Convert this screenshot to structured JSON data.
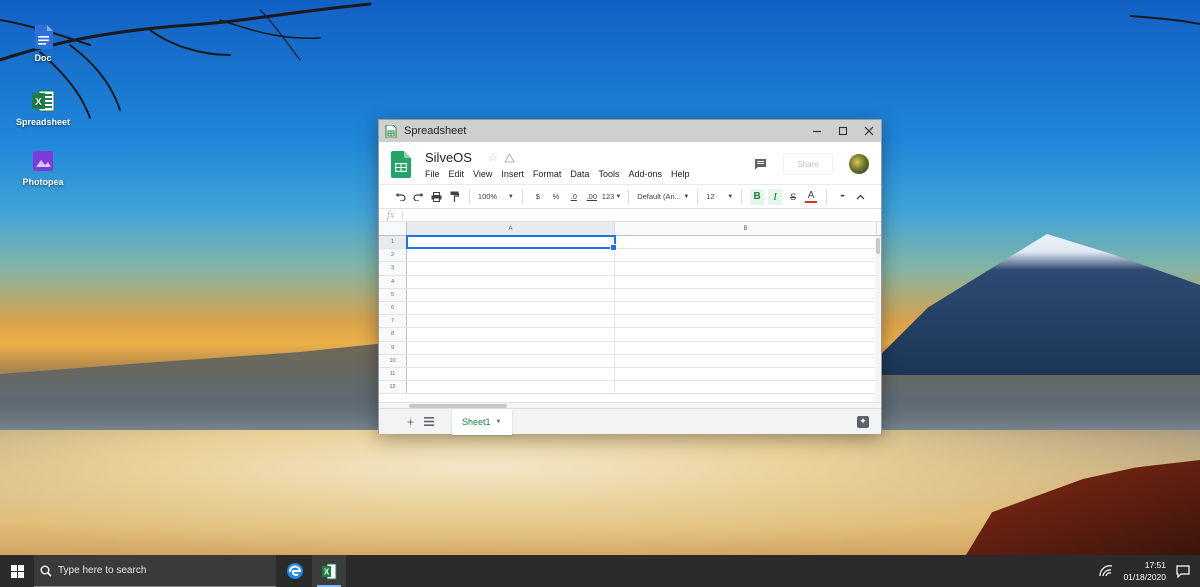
{
  "desktop": {
    "icons": [
      {
        "label": "Doc"
      },
      {
        "label": "Spreadsheet"
      },
      {
        "label": "Photopea"
      }
    ]
  },
  "window": {
    "title": "Spreadsheet",
    "doc_name": "SilveOS",
    "menus": [
      "File",
      "Edit",
      "View",
      "Insert",
      "Format",
      "Data",
      "Tools",
      "Add-ons",
      "Help"
    ],
    "share_label": "Share",
    "toolbar": {
      "zoom": "100%",
      "currency": "$",
      "percent": "%",
      "dec_decrease": ".0",
      "dec_increase": ".00",
      "more_formats": "123",
      "font": "Default (Ari...",
      "font_size": "12",
      "bold": "B",
      "italic": "I",
      "strike": "S",
      "text_color": "A",
      "more": "•••"
    },
    "formula_bar": {
      "fx": "fx",
      "value": ""
    },
    "grid": {
      "columns": [
        "A",
        "B"
      ],
      "rows": [
        "1",
        "2",
        "3",
        "4",
        "5",
        "6",
        "7",
        "8",
        "9",
        "10",
        "11",
        "12"
      ],
      "active_cell": "A1"
    },
    "sheets": [
      {
        "label": "Sheet1"
      }
    ]
  },
  "taskbar": {
    "search_placeholder": "Type here to search",
    "time": "17:51",
    "date": "01/18/2020"
  },
  "colors": {
    "sheets_green": "#188038",
    "selection_blue": "#1a73e8",
    "text_color_underline": "#d93025"
  }
}
